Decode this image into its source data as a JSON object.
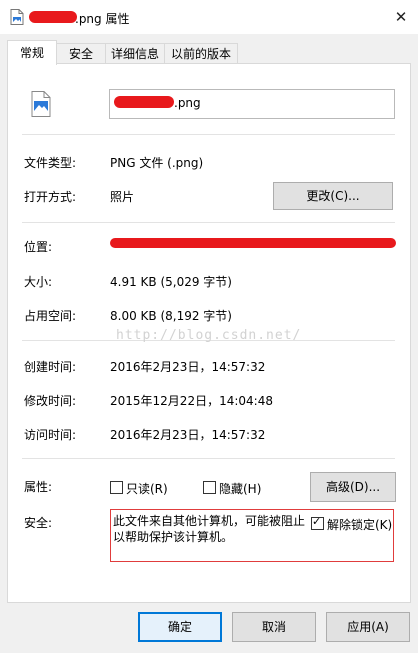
{
  "window": {
    "title_suffix": ".png 属性",
    "close_glyph": "✕"
  },
  "tabs": [
    {
      "label": "常规",
      "active": true
    },
    {
      "label": "安全",
      "active": false
    },
    {
      "label": "详细信息",
      "active": false
    },
    {
      "label": "以前的版本",
      "active": false
    }
  ],
  "general": {
    "filename_suffix": ".png",
    "type_label": "文件类型:",
    "type_value": "PNG 文件 (.png)",
    "open_with_label": "打开方式:",
    "open_with_value": "照片",
    "change_button": "更改(C)...",
    "location_label": "位置:",
    "size_label": "大小:",
    "size_value": "4.91 KB (5,029 字节)",
    "disk_label": "占用空间:",
    "disk_value": "8.00 KB (8,192 字节)",
    "created_label": "创建时间:",
    "created_value": "2016年2月23日，14:57:32",
    "modified_label": "修改时间:",
    "modified_value": "2015年12月22日，14:04:48",
    "accessed_label": "访问时间:",
    "accessed_value": "2016年2月23日，14:57:32",
    "attributes_label": "属性:",
    "readonly_label": "只读(R)",
    "readonly_checked": false,
    "hidden_label": "隐藏(H)",
    "hidden_checked": false,
    "advanced_button": "高级(D)...",
    "security_label": "安全:",
    "security_text": "此文件来自其他计算机，可能被阻止以帮助保护该计算机。",
    "unblock_label": "解除锁定(K)",
    "unblock_checked": true,
    "watermark": "http://blog.csdn.net/"
  },
  "footer": {
    "ok": "确定",
    "cancel": "取消",
    "apply": "应用(A)"
  },
  "colors": {
    "redaction": "#e8191c",
    "security_border": "#e03c3c",
    "default_button_border": "#0078d7"
  },
  "icons": {
    "title": "image-file-icon",
    "file": "image-file-icon",
    "close": "close-icon"
  }
}
